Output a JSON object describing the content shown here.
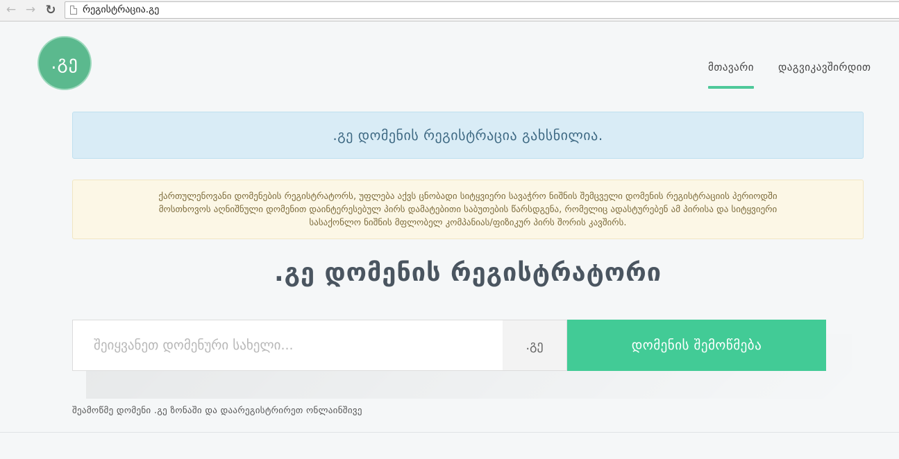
{
  "browser": {
    "back_icon": "arrow-left-icon",
    "forward_icon": "arrow-right-icon",
    "reload_icon": "reload-icon",
    "url": "რეგისტრაცია.გე"
  },
  "header": {
    "logo_text": ".გე",
    "nav": [
      {
        "label": "მთავარი",
        "active": true
      },
      {
        "label": "დაგვიკავშირდით",
        "active": false
      }
    ]
  },
  "alerts": {
    "info": ".გე დომენის რეგისტრაცია გახსნილია.",
    "warning_lines": [
      "ქართულენოვანი დომენების რეგისტრატორს, უფლება აქვს ცნობადი სიტყვიერი სავაჭრო ნიშნის შემცველი დომენის რეგისტრაციის პერიოდში",
      "მოსთხოვოს აღნიშნული დომენით დაინტერესებულ პირს დამატებითი საბუთების წარსდგენა, რომელიც ადასტურებენ ამ პირისა და სიტყვიერი",
      "სასაქონლო ნიშნის მფლობელ კომპანიას/ფიზიკურ პირს შორის კავშირს."
    ]
  },
  "main": {
    "title": ".გე დომენის რეგისტრატორი",
    "search": {
      "placeholder": "შეიყვანეთ დომენური სახელი...",
      "value": "",
      "tld": ".გე",
      "button_label": "დომენის შემოწმება"
    },
    "subtext": "შეამოწმე დომენი .გე ზონაში და დაარეგისტრირეთ ონლაინშივე"
  },
  "colors": {
    "accent": "#42cb96",
    "logo_bg": "#5bb98e",
    "info_bg": "#d9ecf6",
    "warning_bg": "#fcf7e6"
  }
}
